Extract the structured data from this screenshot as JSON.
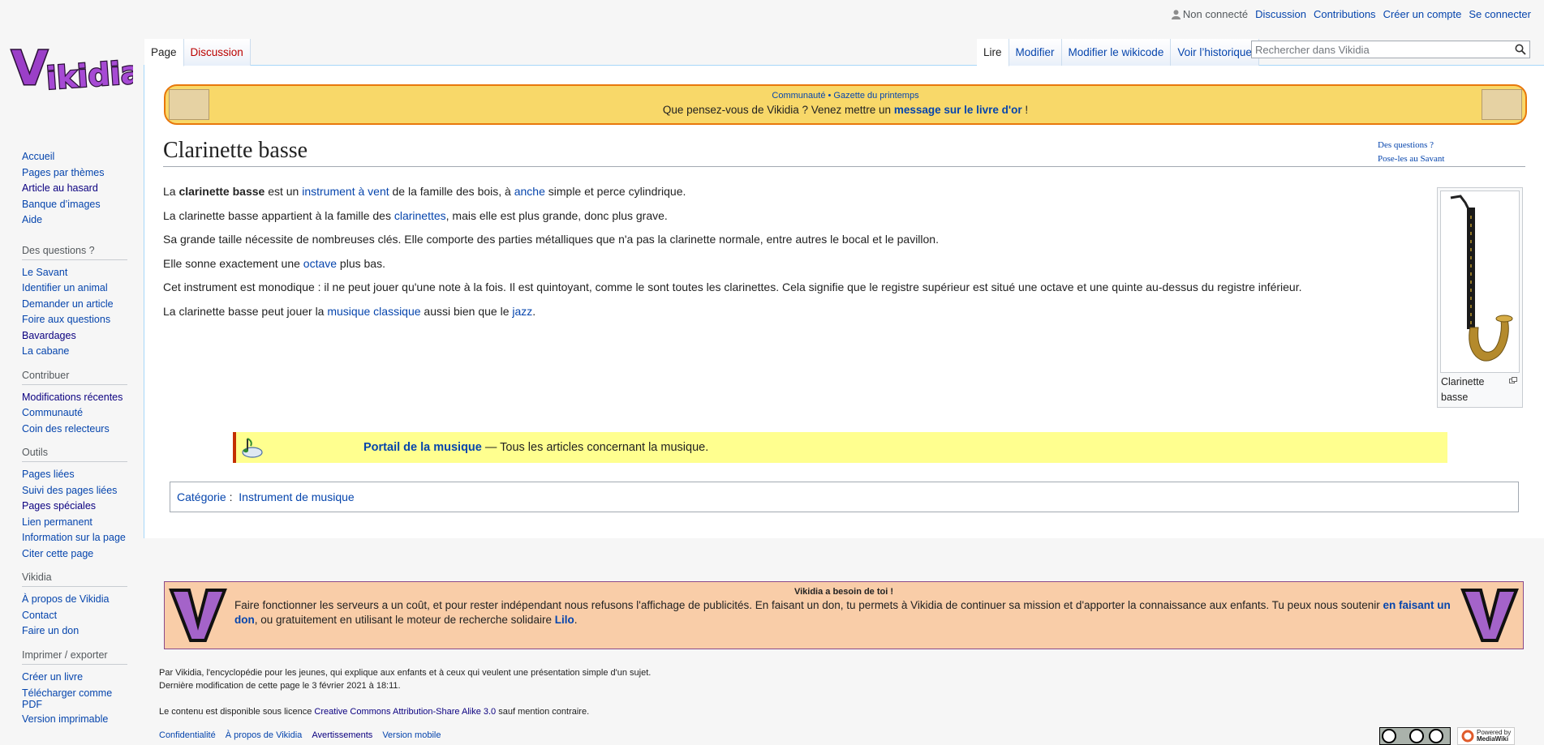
{
  "personal": {
    "not_logged": "Non connecté",
    "discussion": "Discussion",
    "contributions": "Contributions",
    "create_account": "Créer un compte",
    "login": "Se connecter"
  },
  "tabs_left": {
    "page": "Page",
    "discussion": "Discussion"
  },
  "tabs_right": {
    "read": "Lire",
    "edit": "Modifier",
    "edit_source": "Modifier le wikicode",
    "history": "Voir l’historique"
  },
  "search": {
    "placeholder": "Rechercher dans Vikidia"
  },
  "sidebar": {
    "nav": [
      "Accueil",
      "Pages par thèmes",
      "Article au hasard",
      "Banque d’images",
      "Aide"
    ],
    "questions": {
      "title": "Des questions ?",
      "items": [
        "Le Savant",
        "Identifier un animal",
        "Demander un article",
        "Foire aux questions",
        "Bavardages",
        "La cabane"
      ]
    },
    "contribuer": {
      "title": "Contribuer",
      "items": [
        "Modifications récentes",
        "Communauté",
        "Coin des relecteurs"
      ]
    },
    "outils": {
      "title": "Outils",
      "items": [
        "Pages liées",
        "Suivi des pages liées",
        "Pages spéciales",
        "Lien permanent",
        "Information sur la page",
        "Citer cette page"
      ]
    },
    "vikidia": {
      "title": "Vikidia",
      "items": [
        "À propos de Vikidia",
        "Contact",
        "Faire un don"
      ]
    },
    "export": {
      "title": "Imprimer / exporter",
      "items": [
        "Créer un livre",
        "Télécharger comme PDF",
        "Version imprimable"
      ]
    }
  },
  "banner": {
    "top_left": "Communauté",
    "top_sep": " • ",
    "top_right": "Gazette du printemps",
    "main_before": "Que pensez-vous de Vikidia ? Venez mettre un ",
    "main_link": "message sur le livre d'or",
    "main_after": " !"
  },
  "title": "Clarinette basse",
  "savant": {
    "line1": "Des questions ?",
    "line2": "Pose-les au Savant"
  },
  "article": {
    "p1": {
      "a": "La ",
      "b": "clarinette basse",
      "c": " est un ",
      "link1": "instrument à vent",
      "d": " de la famille des bois, à ",
      "link2": "anche",
      "e": " simple et perce cylindrique."
    },
    "p2": {
      "a": "La clarinette basse appartient à la famille des ",
      "link": "clarinettes",
      "b": ", mais elle est plus grande, donc plus grave."
    },
    "p3": "Sa grande taille nécessite de nombreuses clés. Elle comporte des parties métalliques que n'a pas la clarinette normale, entre autres le bocal et le pavillon.",
    "p4": {
      "a": "Elle sonne exactement une ",
      "link": "octave",
      "b": " plus bas."
    },
    "p5": "Cet instrument est monodique : il ne peut jouer qu'une note à la fois. Il est quintoyant, comme le sont toutes les clarinettes. Cela signifie que le registre supérieur est situé une octave et une quinte au-dessus du registre inférieur.",
    "p6": {
      "a": "La clarinette basse peut jouer la ",
      "link1": "musique classique",
      "b": " aussi bien que le ",
      "link2": "jazz",
      "c": "."
    }
  },
  "thumb": {
    "caption": "Clarinette basse"
  },
  "portal": {
    "link": "Portail de la musique",
    "text": " — Tous les articles concernant la musique."
  },
  "categories": {
    "label": "Catégorie",
    "sep": " : ",
    "item": "Instrument de musique"
  },
  "donate": {
    "heading": "Vikidia a besoin de toi !",
    "text_before": "Faire fonctionner les serveurs a un coût, et pour rester indépendant nous refusons l'affichage de publicités. En faisant un don, tu permets à Vikidia de continuer sa mission et d'apporter la connaissance aux enfants. Tu peux nous soutenir ",
    "link1": "en faisant un don",
    "text_mid": ", ou gratuitement en utilisant le moteur de recherche solidaire ",
    "link2": "Lilo",
    "text_after": "."
  },
  "footer": {
    "line1": "Par Vikidia, l'encyclopédie pour les jeunes, qui explique aux enfants et à ceux qui veulent une présentation simple d'un sujet.",
    "line2": "Dernière modification de cette page le 3 février 2021 à 18:11.",
    "line3_before": "Le contenu est disponible sous licence ",
    "line3_link": "Creative Commons Attribution-Share Alike 3.0",
    "line3_after": " sauf mention contraire.",
    "places": [
      "Confidentialité",
      "À propos de Vikidia",
      "Avertissements",
      "Version mobile"
    ],
    "powered_small": "Powered by",
    "powered_big": "MediaWiki"
  },
  "colors": {
    "link": "#0645ad",
    "new_link": "#ba0000",
    "banner_bg": "#f8d869",
    "portal_bg": "#ffff8f",
    "donate_bg": "#f9cda8"
  }
}
